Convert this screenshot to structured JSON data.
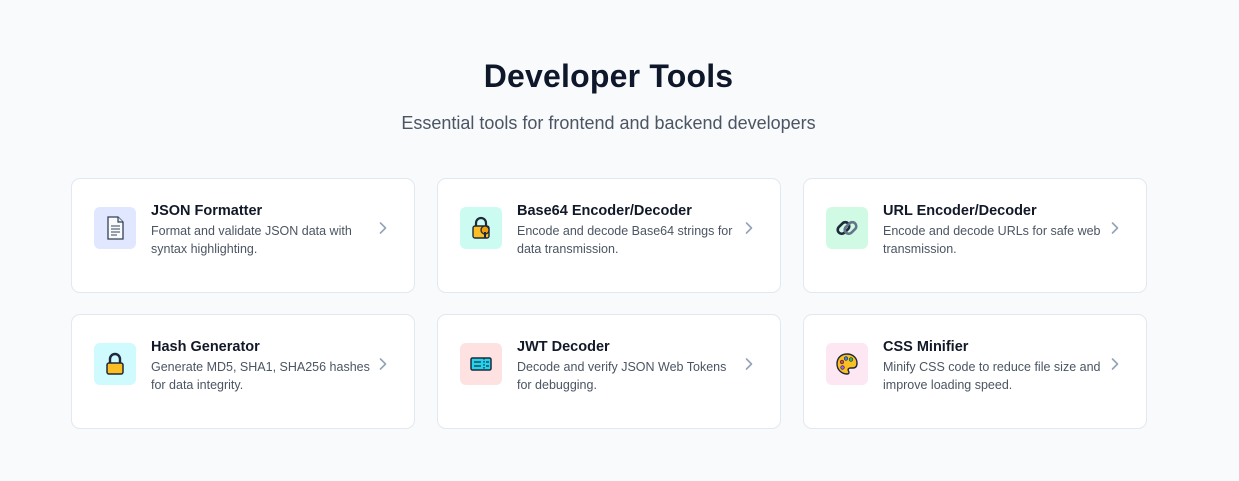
{
  "header": {
    "title": "Developer Tools",
    "subtitle": "Essential tools for frontend and backend developers"
  },
  "tools": [
    {
      "title": "JSON Formatter",
      "description": "Format and validate JSON data with syntax highlighting.",
      "icon": "document-icon",
      "icon_bg": "#e0e7ff"
    },
    {
      "title": "Base64 Encoder/Decoder",
      "description": "Encode and decode Base64 strings for data transmission.",
      "icon": "lock-key-icon",
      "icon_bg": "#ccfbf1"
    },
    {
      "title": "URL Encoder/Decoder",
      "description": "Encode and decode URLs for safe web transmission.",
      "icon": "link-icon",
      "icon_bg": "#d1fae5"
    },
    {
      "title": "Hash Generator",
      "description": "Generate MD5, SHA1, SHA256 hashes for data integrity.",
      "icon": "padlock-icon",
      "icon_bg": "#cffafe"
    },
    {
      "title": "JWT Decoder",
      "description": "Decode and verify JSON Web Tokens for debugging.",
      "icon": "ticket-icon",
      "icon_bg": "#fee2e2"
    },
    {
      "title": "CSS Minifier",
      "description": "Minify CSS code to reduce file size and improve loading speed.",
      "icon": "palette-icon",
      "icon_bg": "#fce7f3"
    }
  ]
}
